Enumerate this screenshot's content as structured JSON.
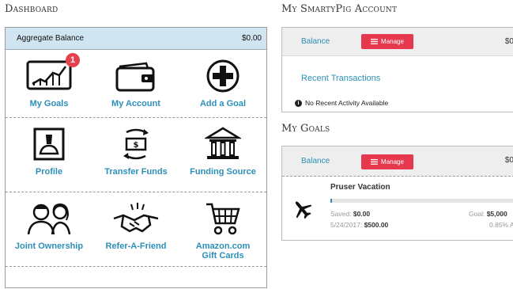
{
  "dashboard": {
    "title": "Dashboard",
    "aggregate_label": "Aggregate Balance",
    "aggregate_value": "$0.00",
    "tiles": [
      {
        "label": "My Goals",
        "icon": "goals-chart-icon",
        "badge": "1"
      },
      {
        "label": "My Account",
        "icon": "wallet-icon"
      },
      {
        "label": "Add a Goal",
        "icon": "plus-circle-icon"
      },
      {
        "label": "Profile",
        "icon": "profile-icon"
      },
      {
        "label": "Transfer Funds",
        "icon": "transfer-funds-icon"
      },
      {
        "label": "Funding Source",
        "icon": "bank-icon"
      },
      {
        "label": "Joint Ownership",
        "icon": "joint-ownership-icon"
      },
      {
        "label": "Refer-A-Friend",
        "icon": "handshake-icon"
      },
      {
        "label": "Amazon.com",
        "label2": "Gift Cards",
        "icon": "shopping-cart-icon"
      }
    ]
  },
  "account": {
    "title": "My SmartyPig Account",
    "balance_label": "Balance",
    "manage_label": "Manage",
    "balance_value_cut": "$0",
    "recent_label": "Recent Transactions",
    "no_activity": "No Recent Activity Available"
  },
  "goals": {
    "title": "My Goals",
    "balance_label": "Balance",
    "manage_label": "Manage",
    "balance_value_cut": "$0",
    "items": [
      {
        "name": "Pruser Vacation",
        "icon": "airplane-icon",
        "saved_label": "Saved:",
        "saved_value": "$0.00",
        "date_label": "5/24/2017:",
        "date_value": "$500.00",
        "goal_label": "Goal:",
        "goal_value": "$5,000",
        "percent": "0.85% A",
        "progress": 0.0085
      }
    ]
  },
  "colors": {
    "accent_blue": "#2d8fb8",
    "manage_red": "#e63950",
    "header_blue": "#cfe6f2",
    "badge_red": "#e8404f"
  }
}
